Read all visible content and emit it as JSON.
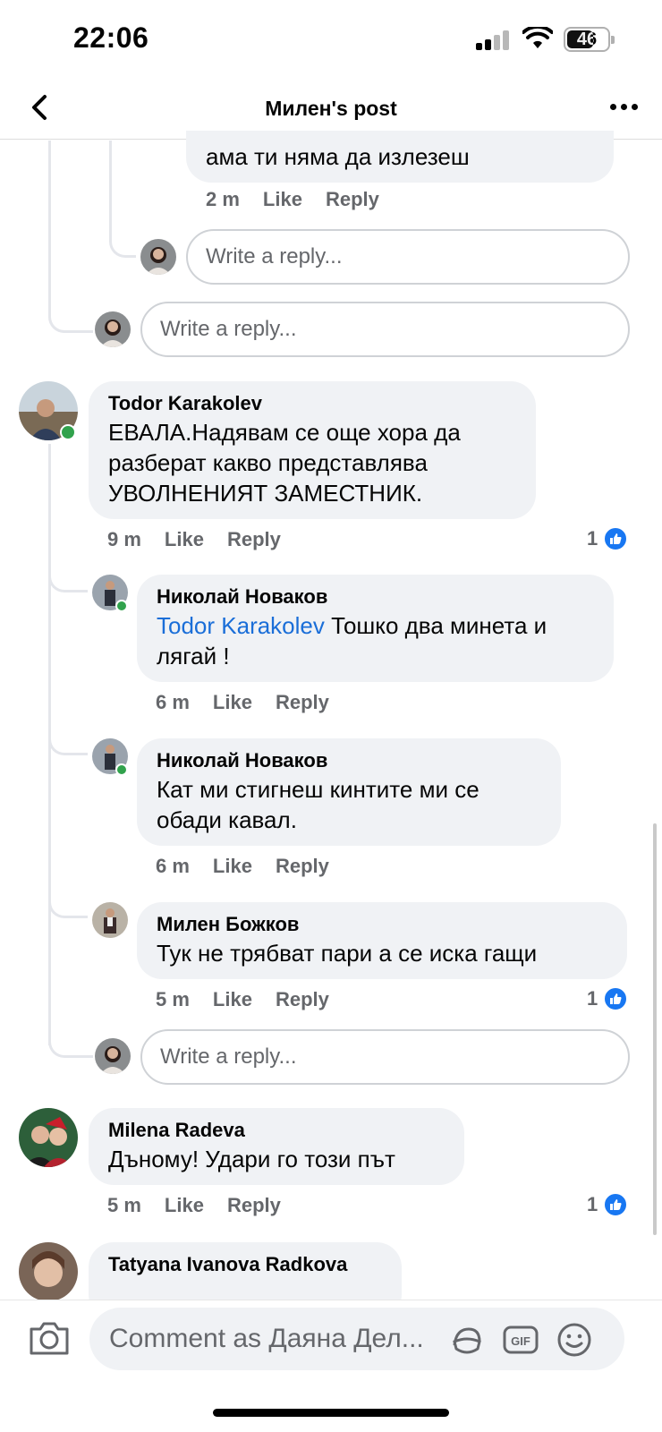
{
  "status_bar": {
    "time": "22:06",
    "battery": "46"
  },
  "header": {
    "title": "Милен's post"
  },
  "prior_reply": {
    "text_tail": "ама ти няма да излезеш",
    "time": "2 m",
    "like": "Like",
    "reply": "Reply"
  },
  "inputs": {
    "write_reply": "Write a reply..."
  },
  "comments": [
    {
      "author": "Todor Karakolev",
      "text": "ЕВАЛА.Надявам се още хора да разберат какво представлява УВОЛНЕНИЯТ ЗАМЕСТНИК.",
      "time": "9 m",
      "like": "Like",
      "reply": "Reply",
      "reactions": "1",
      "replies": [
        {
          "author": "Николай Новаков",
          "mention": "Todor Karakolev",
          "text": " Тошко два минета и лягай !",
          "time": "6 m",
          "like": "Like",
          "reply": "Reply"
        },
        {
          "author": "Николай Новаков",
          "text": "Кат ми стигнеш кинтите ми се обади кавал.",
          "time": "6 m",
          "like": "Like",
          "reply": "Reply"
        },
        {
          "author": "Милен Божков",
          "text": "Тук не трябват пари а се иска гащи",
          "time": "5 m",
          "like": "Like",
          "reply": "Reply",
          "reactions": "1"
        }
      ]
    },
    {
      "author": "Milena Radeva",
      "text": "Дъному! Удари го този път",
      "time": "5 m",
      "like": "Like",
      "reply": "Reply",
      "reactions": "1"
    },
    {
      "author": "Tatyana Ivanova Radkova"
    }
  ],
  "composer": {
    "placeholder": "Comment as Даяна Дел..."
  },
  "colors": {
    "link": "#1a6ed8",
    "like_blue": "#1877f2",
    "bubble": "#f0f2f5",
    "online": "#31a24c",
    "meta": "#65676b"
  }
}
